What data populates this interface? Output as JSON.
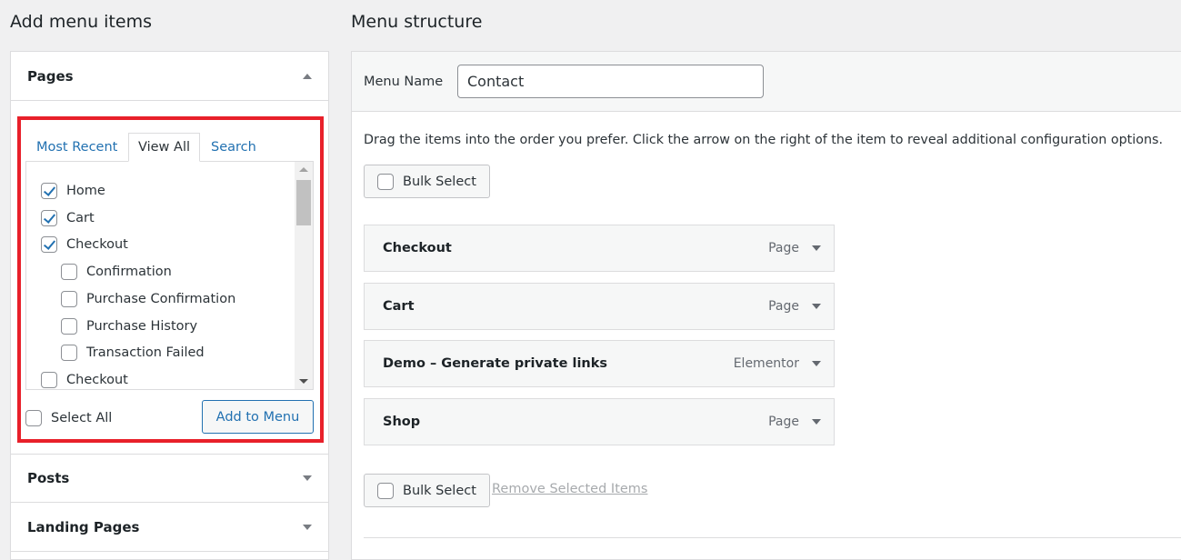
{
  "left": {
    "title": "Add menu items",
    "pages": {
      "title": "Pages",
      "tabs": [
        "Most Recent",
        "View All",
        "Search"
      ],
      "items": [
        {
          "label": "Home",
          "checked": true,
          "level": 0
        },
        {
          "label": "Cart",
          "checked": true,
          "level": 0
        },
        {
          "label": "Checkout",
          "checked": true,
          "level": 0
        },
        {
          "label": "Confirmation",
          "checked": false,
          "level": 1
        },
        {
          "label": "Purchase Confirmation",
          "checked": false,
          "level": 1
        },
        {
          "label": "Purchase History",
          "checked": false,
          "level": 1
        },
        {
          "label": "Transaction Failed",
          "checked": false,
          "level": 1
        },
        {
          "label": "Checkout",
          "checked": false,
          "level": 0
        }
      ],
      "select_all": "Select All",
      "add_button": "Add to Menu",
      "highlight_color": "#e8202a"
    },
    "sections": [
      "Posts",
      "Landing Pages"
    ]
  },
  "right": {
    "title": "Menu structure",
    "menu_name_label": "Menu Name",
    "menu_name_value": "Contact",
    "instructions": "Drag the items into the order you prefer. Click the arrow on the right of the item to reveal additional configuration options.",
    "bulk_select": "Bulk Select",
    "items": [
      {
        "title": "Checkout",
        "type": "Page"
      },
      {
        "title": "Cart",
        "type": "Page"
      },
      {
        "title": "Demo – Generate private links",
        "type": "Elementor"
      },
      {
        "title": "Shop",
        "type": "Page"
      }
    ],
    "remove_selected": "Remove Selected Items"
  }
}
